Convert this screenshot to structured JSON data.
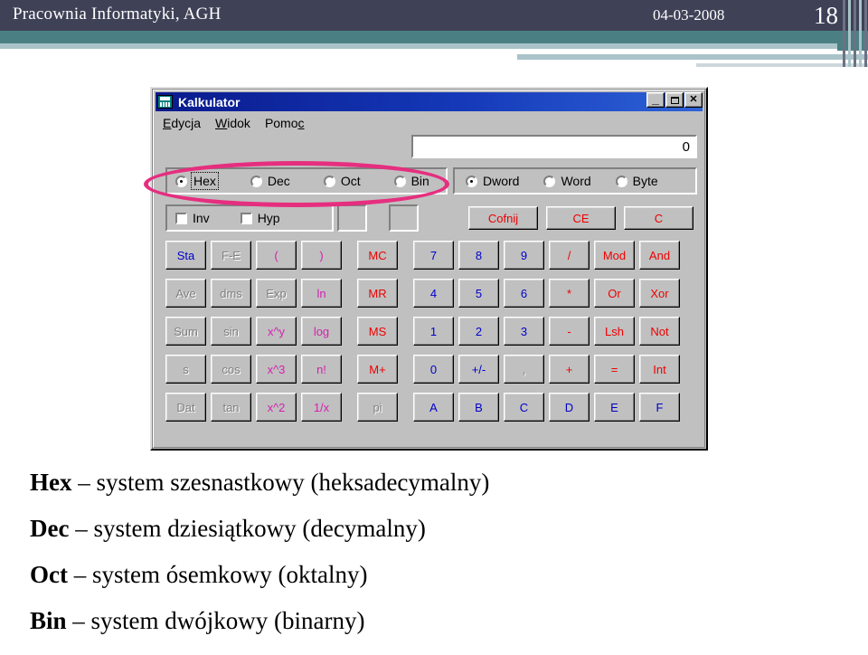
{
  "header": {
    "title": "Pracownia Informatyki, AGH",
    "date": "04-03-2008",
    "page_number": "18",
    "bg_color": "#3f4257",
    "band_color": "#4a8084"
  },
  "calculator": {
    "window_title": "Kalkulator",
    "window_controls": {
      "minimize": "_",
      "maximize": "",
      "close": "✕"
    },
    "menu": [
      {
        "label": "Edycja",
        "accel": "E"
      },
      {
        "label": "Widok",
        "accel": "W"
      },
      {
        "label": "Pomoc",
        "accel": "c"
      }
    ],
    "display_value": "0",
    "base_modes": [
      {
        "label": "Hex",
        "checked": true,
        "focused": true
      },
      {
        "label": "Dec",
        "checked": false,
        "focused": false
      },
      {
        "label": "Oct",
        "checked": false,
        "focused": false
      },
      {
        "label": "Bin",
        "checked": false,
        "focused": false
      }
    ],
    "word_sizes": [
      {
        "label": "Dword",
        "checked": true
      },
      {
        "label": "Word",
        "checked": false
      },
      {
        "label": "Byte",
        "checked": false
      }
    ],
    "flags": [
      {
        "label": "Inv",
        "checked": false
      },
      {
        "label": "Hyp",
        "checked": false
      }
    ],
    "edit_buttons": [
      {
        "label": "Cofnij",
        "color": "red"
      },
      {
        "label": "CE",
        "color": "red"
      },
      {
        "label": "C",
        "color": "red"
      }
    ],
    "keypad_rows": [
      [
        {
          "label": "Sta",
          "color": "blue"
        },
        {
          "label": "F-E",
          "color": "gray"
        },
        {
          "label": "(",
          "color": "magenta"
        },
        {
          "label": ")",
          "color": "magenta"
        },
        {
          "label": "MC",
          "color": "red"
        },
        {
          "label": "7",
          "color": "blue"
        },
        {
          "label": "8",
          "color": "blue"
        },
        {
          "label": "9",
          "color": "blue"
        },
        {
          "label": "/",
          "color": "red"
        },
        {
          "label": "Mod",
          "color": "red"
        },
        {
          "label": "And",
          "color": "red"
        }
      ],
      [
        {
          "label": "Ave",
          "color": "gray"
        },
        {
          "label": "dms",
          "color": "gray"
        },
        {
          "label": "Exp",
          "color": "gray"
        },
        {
          "label": "ln",
          "color": "magenta"
        },
        {
          "label": "MR",
          "color": "red"
        },
        {
          "label": "4",
          "color": "blue"
        },
        {
          "label": "5",
          "color": "blue"
        },
        {
          "label": "6",
          "color": "blue"
        },
        {
          "label": "*",
          "color": "red"
        },
        {
          "label": "Or",
          "color": "red"
        },
        {
          "label": "Xor",
          "color": "red"
        }
      ],
      [
        {
          "label": "Sum",
          "color": "gray"
        },
        {
          "label": "sin",
          "color": "gray"
        },
        {
          "label": "x^y",
          "color": "magenta"
        },
        {
          "label": "log",
          "color": "magenta"
        },
        {
          "label": "MS",
          "color": "red"
        },
        {
          "label": "1",
          "color": "blue"
        },
        {
          "label": "2",
          "color": "blue"
        },
        {
          "label": "3",
          "color": "blue"
        },
        {
          "label": "-",
          "color": "red"
        },
        {
          "label": "Lsh",
          "color": "red"
        },
        {
          "label": "Not",
          "color": "red"
        }
      ],
      [
        {
          "label": "s",
          "color": "gray"
        },
        {
          "label": "cos",
          "color": "gray"
        },
        {
          "label": "x^3",
          "color": "magenta"
        },
        {
          "label": "n!",
          "color": "magenta"
        },
        {
          "label": "M+",
          "color": "red"
        },
        {
          "label": "0",
          "color": "blue"
        },
        {
          "label": "+/-",
          "color": "blue"
        },
        {
          "label": ",",
          "color": "gray"
        },
        {
          "label": "+",
          "color": "red"
        },
        {
          "label": "=",
          "color": "red"
        },
        {
          "label": "Int",
          "color": "red"
        }
      ],
      [
        {
          "label": "Dat",
          "color": "gray"
        },
        {
          "label": "tan",
          "color": "gray"
        },
        {
          "label": "x^2",
          "color": "magenta"
        },
        {
          "label": "1/x",
          "color": "magenta"
        },
        {
          "label": "pi",
          "color": "gray"
        },
        {
          "label": "A",
          "color": "blue"
        },
        {
          "label": "B",
          "color": "blue"
        },
        {
          "label": "C",
          "color": "blue"
        },
        {
          "label": "D",
          "color": "blue"
        },
        {
          "label": "E",
          "color": "blue"
        },
        {
          "label": "F",
          "color": "blue"
        }
      ]
    ]
  },
  "annotation": {
    "ellipse_color": "#e62e7f",
    "target": "base-mode-radio-group"
  },
  "body_text": [
    {
      "term": "Hex",
      "rest": " – system szesnastkowy (heksadecymalny)"
    },
    {
      "term": "Dec",
      "rest": " – system dziesiątkowy (decymalny)"
    },
    {
      "term": "Oct",
      "rest": " – system ósemkowy (oktalny)"
    },
    {
      "term": "Bin",
      "rest": " – system dwójkowy (binarny)"
    }
  ]
}
